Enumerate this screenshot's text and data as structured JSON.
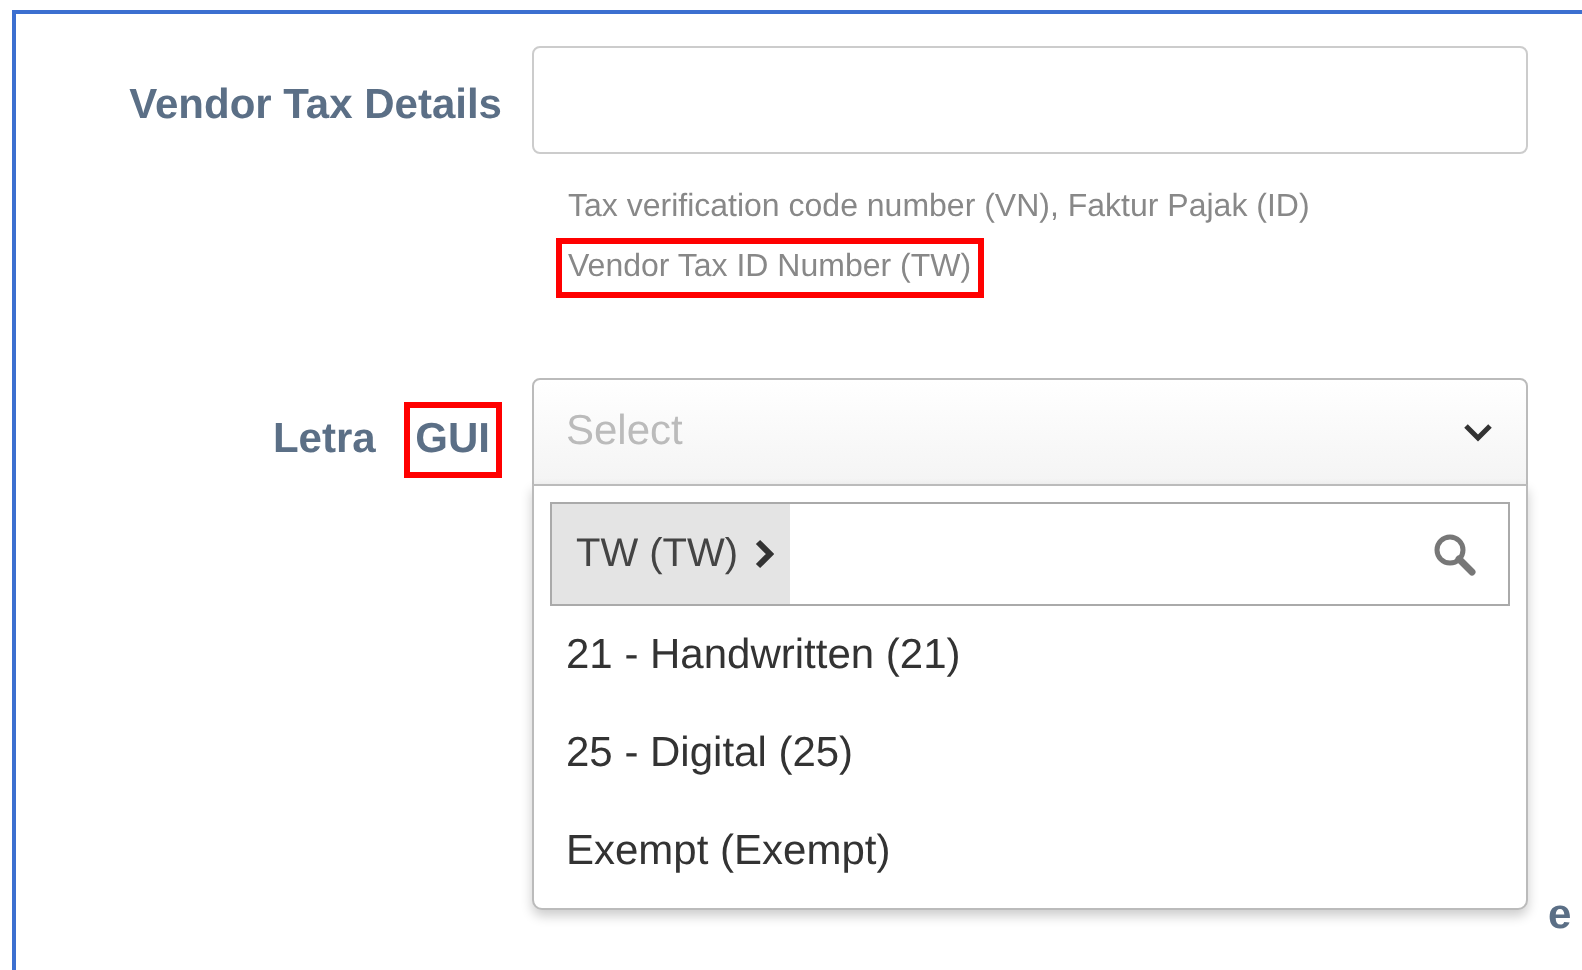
{
  "fields": [
    {
      "kind": "text",
      "label": "Vendor Tax Details",
      "help": [
        {
          "text": "Tax verification code number (VN), Faktur Pajak (ID)",
          "highlighted": false
        },
        {
          "text": "Vendor Tax ID Number (TW)",
          "highlighted": true
        }
      ]
    },
    {
      "kind": "select",
      "label": [
        {
          "text": "Letra",
          "highlighted": false
        },
        {
          "text": "GUI",
          "highlighted": true
        }
      ],
      "placeholder": "Select",
      "expanded": true,
      "dropdown": {
        "breadcrumb": "TW (TW)",
        "options": [
          {
            "label": "21 - Handwritten (21)"
          },
          {
            "label": "25 - Digital (25)"
          },
          {
            "label": "Exempt (Exempt)"
          }
        ]
      }
    }
  ],
  "background_fragment": "e"
}
